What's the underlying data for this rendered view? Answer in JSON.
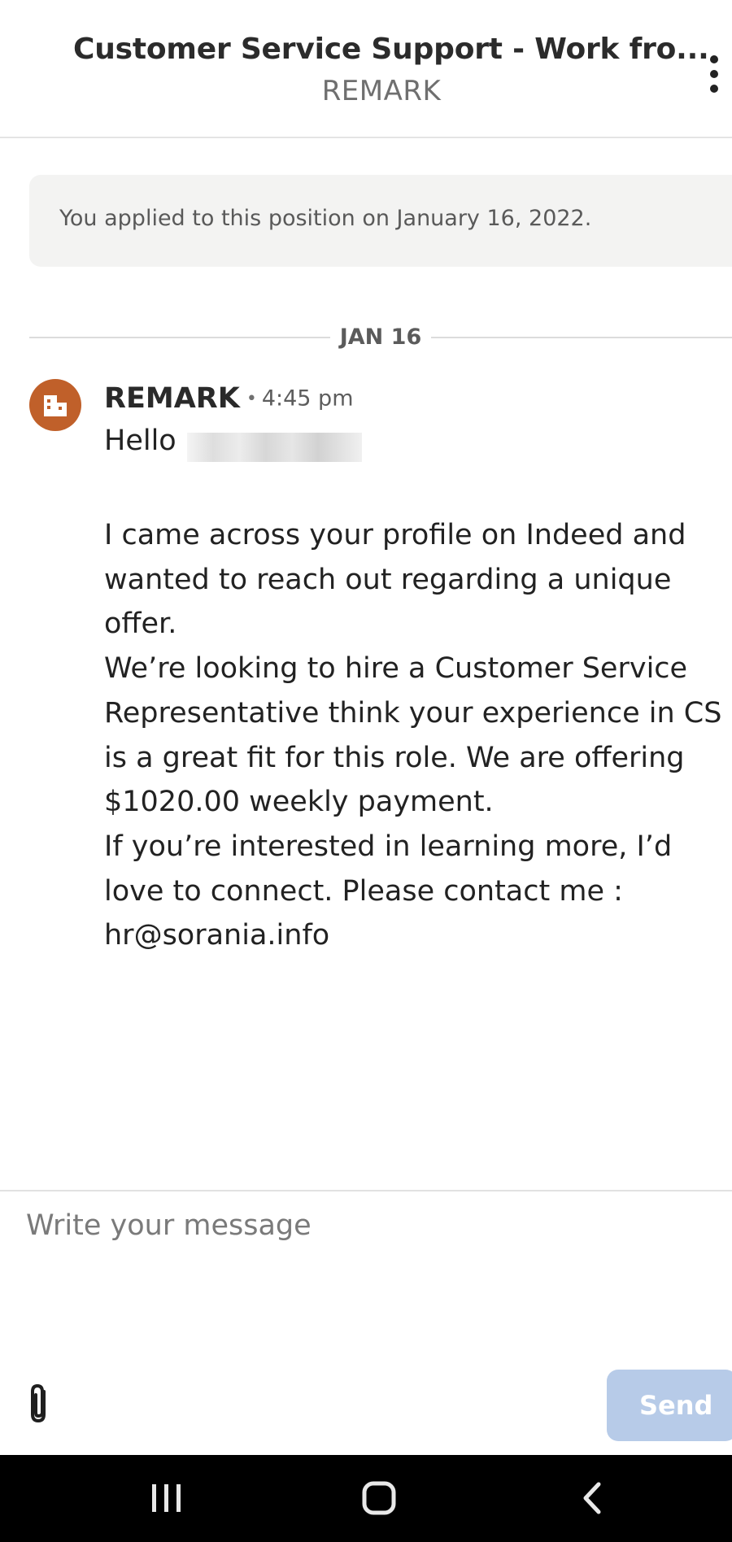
{
  "header": {
    "title": "Customer Service Support - Work fro...",
    "subtitle": "REMARK",
    "menu_icon": "more-vertical-icon"
  },
  "applied_banner": {
    "text": "You applied to this position on January 16, 2022."
  },
  "date_divider": {
    "label": "JAN 16"
  },
  "message": {
    "avatar_icon": "building-icon",
    "avatar_color": "#c0602a",
    "sender": "REMARK",
    "separator": "•",
    "time": "4:45 pm",
    "greeting": "Hello",
    "body": [
      "I came across your profile on Indeed and wanted to reach out regarding a unique offer.",
      "We’re looking to hire a Customer Service Representative think your experience in CS is a great fit for this role. We are offering $1020.00 weekly payment.",
      "If you’re interested in learning more, I’d love to connect. Please contact me : hr@sorania.info"
    ]
  },
  "composer": {
    "placeholder": "Write your message",
    "attach_icon": "paperclip-icon",
    "send_label": "Send",
    "send_color": "#b7cbe8"
  },
  "system_nav": {
    "recent_icon": "recent-apps-icon",
    "home_icon": "home-icon",
    "back_icon": "back-icon"
  }
}
